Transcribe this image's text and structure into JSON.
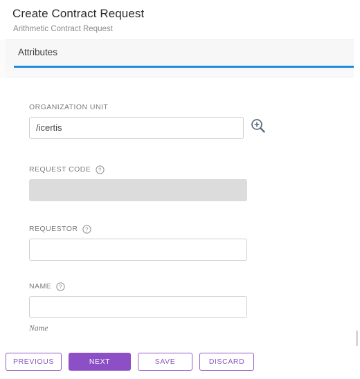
{
  "header": {
    "title": "Create Contract Request",
    "subtitle": "Arithmetic Contract Request"
  },
  "tabs": [
    {
      "label": "Attributes",
      "active": true
    }
  ],
  "form": {
    "fields": [
      {
        "label": "ORGANIZATION UNIT",
        "value": "/icertis",
        "placeholder": "",
        "has_help_icon": false,
        "has_search_button": true,
        "search_icon": "magnifier-plus-icon",
        "disabled": false,
        "helper_text": ""
      },
      {
        "label": "REQUEST CODE",
        "value": "",
        "placeholder": "",
        "has_help_icon": true,
        "help_icon": "help-circle-icon",
        "has_search_button": false,
        "disabled": true,
        "helper_text": ""
      },
      {
        "label": "REQUESTOR",
        "value": "",
        "placeholder": "",
        "has_help_icon": true,
        "help_icon": "help-circle-icon",
        "has_search_button": false,
        "disabled": false,
        "helper_text": ""
      },
      {
        "label": "NAME",
        "value": "",
        "placeholder": "",
        "has_help_icon": true,
        "help_icon": "help-circle-icon",
        "has_search_button": false,
        "disabled": false,
        "helper_text": "Name"
      }
    ]
  },
  "footer": {
    "buttons": [
      {
        "label": "PREVIOUS",
        "style": "outline"
      },
      {
        "label": "NEXT",
        "style": "primary"
      },
      {
        "label": "SAVE",
        "style": "outline"
      },
      {
        "label": "DISCARD",
        "style": "outline"
      }
    ]
  },
  "colors": {
    "tab_accent": "#1b8cdd",
    "button_primary": "#8c4fc6",
    "button_outline_text": "#8a56bd",
    "disabled_field": "#dcdcdc",
    "label_text": "#7b7b7b",
    "title_text": "#2b2b2b",
    "subtitle_text": "#8a8a8a"
  }
}
